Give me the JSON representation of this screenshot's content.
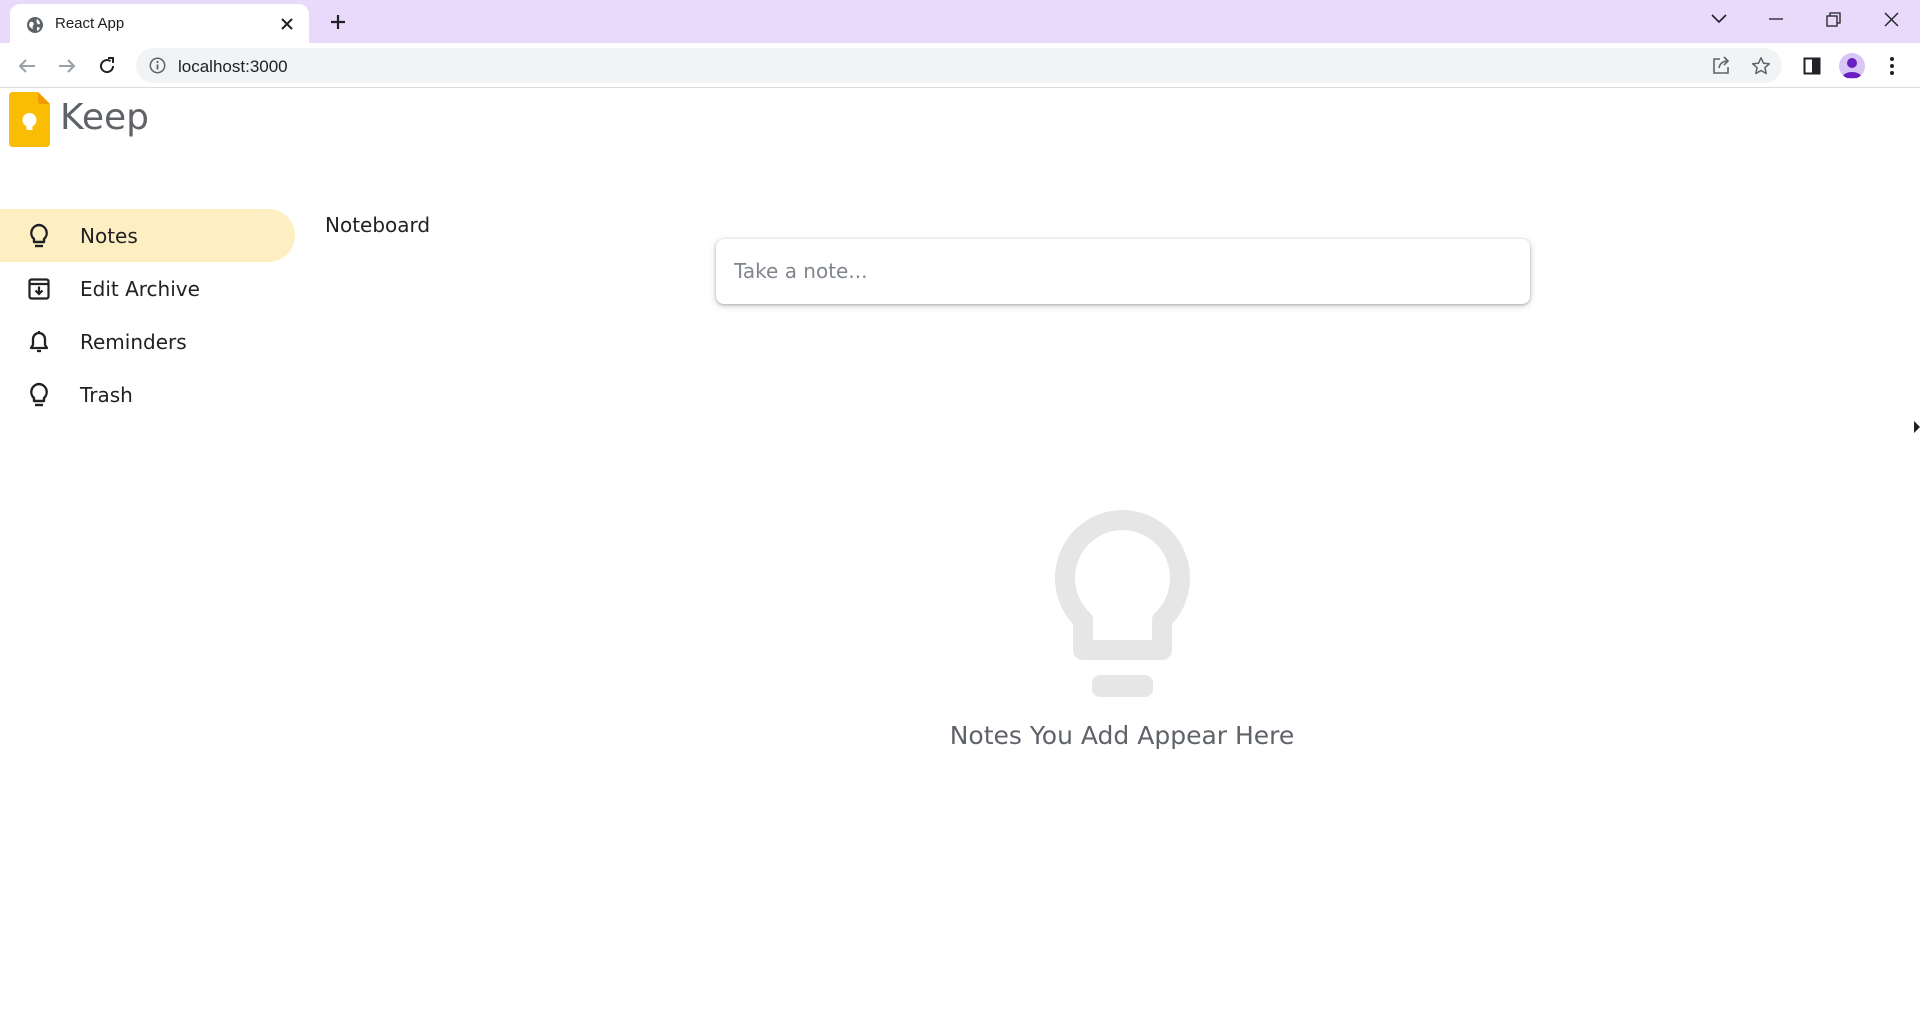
{
  "browser": {
    "tab": {
      "title": "React App"
    },
    "omnibox": {
      "url": "localhost:3000"
    }
  },
  "app": {
    "name": "Keep",
    "colors": {
      "accent": "#fbbc04",
      "active_bg": "#feefc3",
      "muted": "#5f6368"
    }
  },
  "sidebar": {
    "items": [
      {
        "label": "Notes",
        "icon": "lightbulb-icon",
        "active": true
      },
      {
        "label": "Edit Archive",
        "icon": "archive-icon",
        "active": false
      },
      {
        "label": "Reminders",
        "icon": "bell-icon",
        "active": false
      },
      {
        "label": "Trash",
        "icon": "lightbulb-icon",
        "active": false
      }
    ]
  },
  "main": {
    "title": "Noteboard",
    "note_input": {
      "placeholder": "Take a note...",
      "value": ""
    },
    "empty_state": {
      "icon": "lightbulb-icon",
      "message": "Notes You Add Appear Here"
    }
  }
}
